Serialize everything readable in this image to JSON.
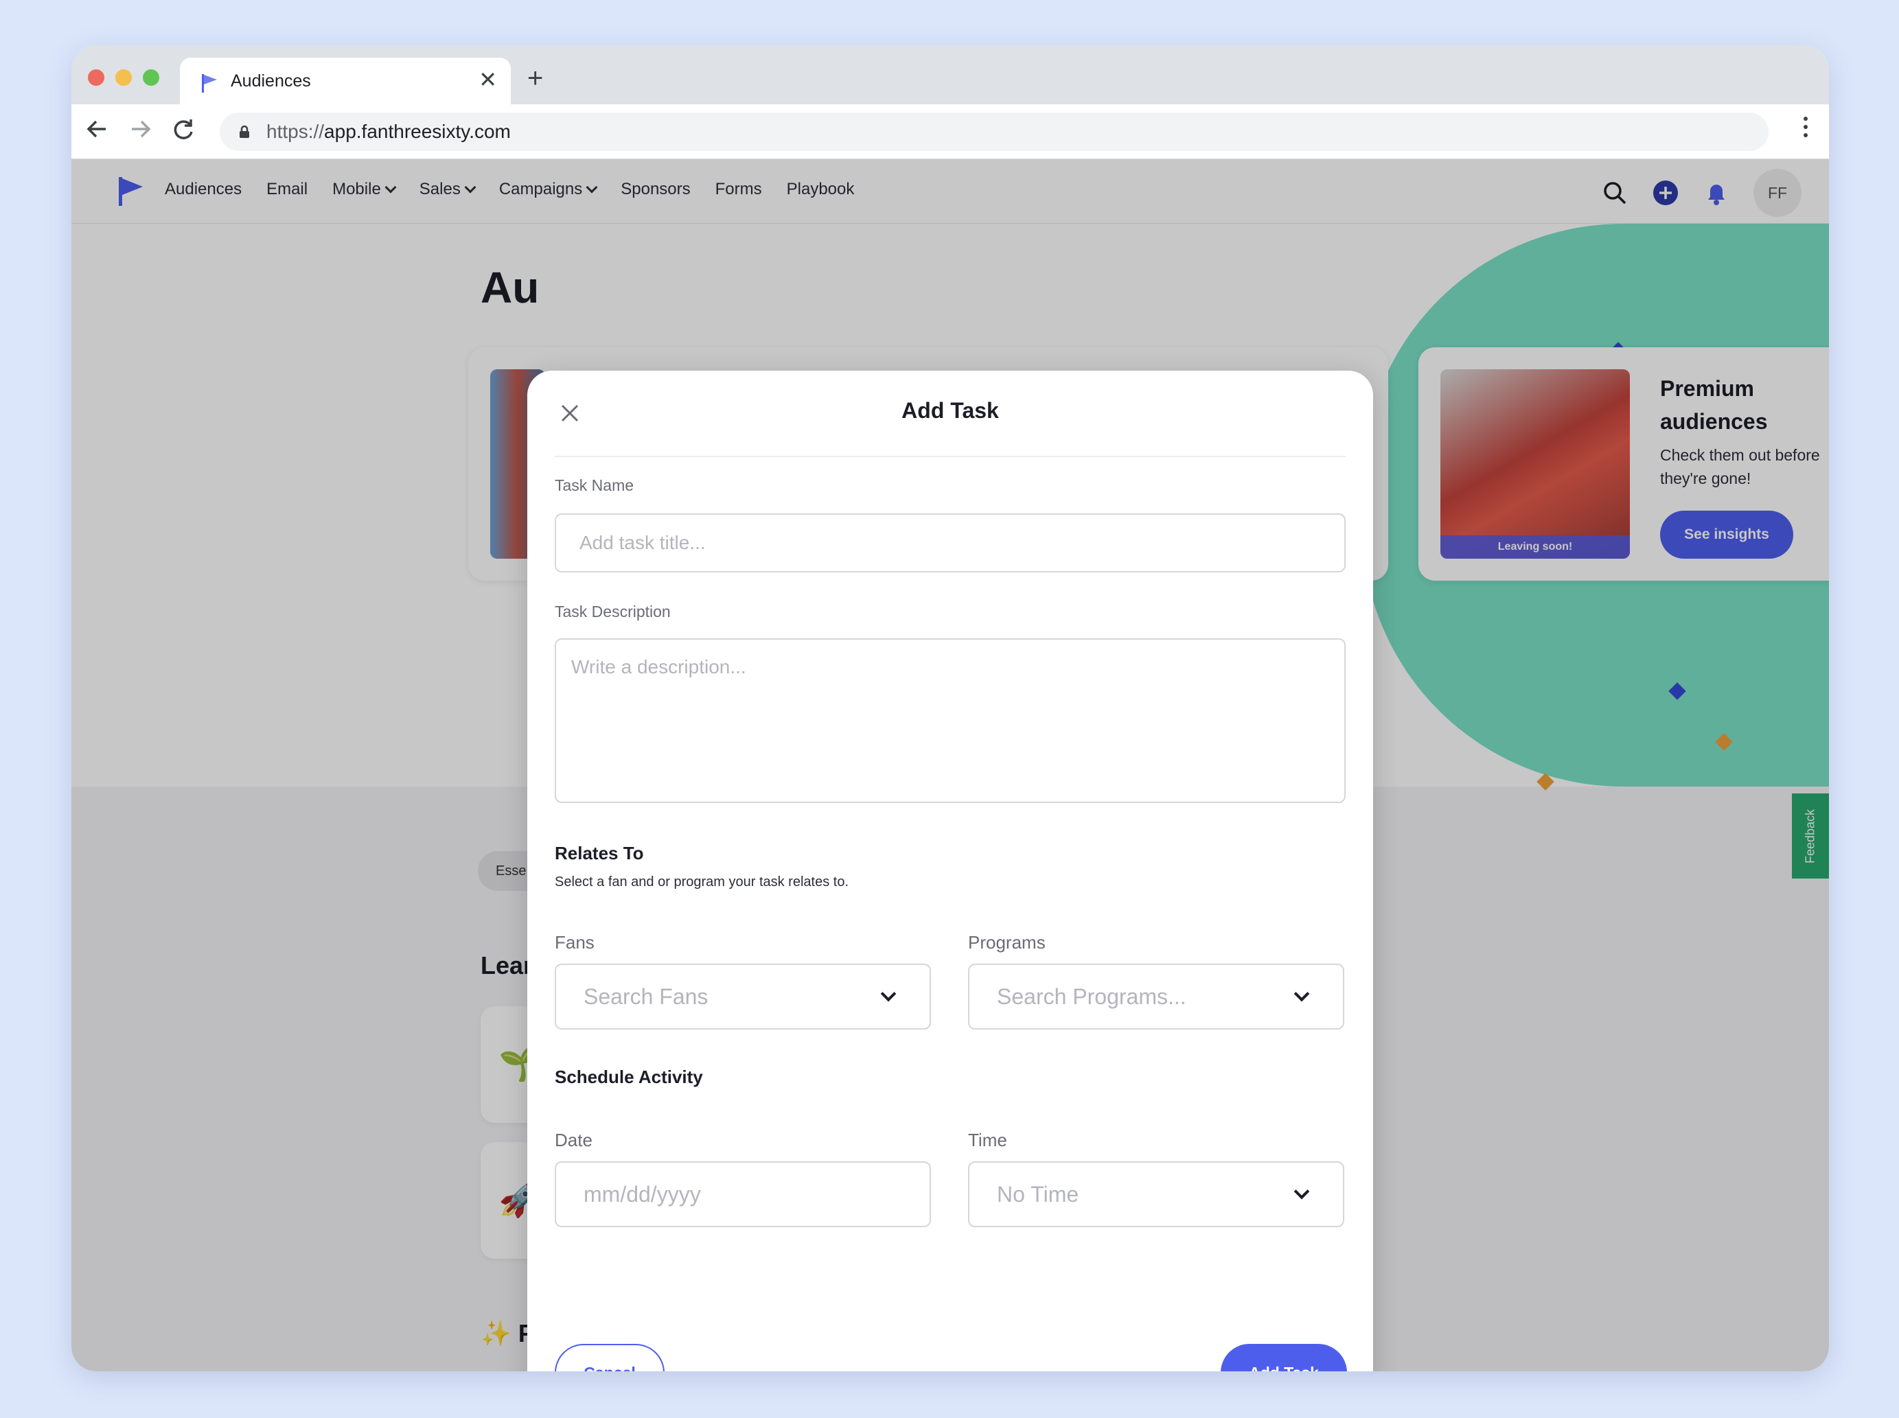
{
  "browser": {
    "tab_title": "Audiences",
    "tab_close": "✕",
    "new_tab": "+",
    "url_scheme": "https://",
    "url_host": "app.fanthreesixty.com"
  },
  "nav": {
    "items": [
      "Audiences",
      "Email",
      "Mobile",
      "Sales",
      "Campaigns",
      "Sponsors",
      "Forms",
      "Playbook"
    ],
    "avatar_initials": "FF"
  },
  "page": {
    "title": "Au",
    "premium": {
      "title": "Premium audiences",
      "subtitle": "Check them out before they're gone!",
      "button": "See insights",
      "badge": "Leaving soon!"
    },
    "filter_pill": "Esse",
    "learn_heading": "Lear",
    "featured_heading": "F",
    "featured_icon": "✨",
    "feedback": "Feedback"
  },
  "modal": {
    "title": "Add Task",
    "task_name_label": "Task Name",
    "task_name_placeholder": "Add task title...",
    "task_desc_label": "Task Description",
    "task_desc_placeholder": "Write a description...",
    "relates_heading": "Relates To",
    "relates_sub": "Select a fan and or program your task relates to.",
    "fans_label": "Fans",
    "fans_placeholder": "Search Fans",
    "programs_label": "Programs",
    "programs_placeholder": "Search Programs...",
    "schedule_heading": "Schedule Activity",
    "date_label": "Date",
    "date_placeholder": "mm/dd/yyyy",
    "time_label": "Time",
    "time_value": "No Time",
    "cancel": "Cancel",
    "submit": "Add Task"
  },
  "colors": {
    "accent": "#4e5eec",
    "teal": "#7ae0c6",
    "feedback": "#2aa86e"
  }
}
